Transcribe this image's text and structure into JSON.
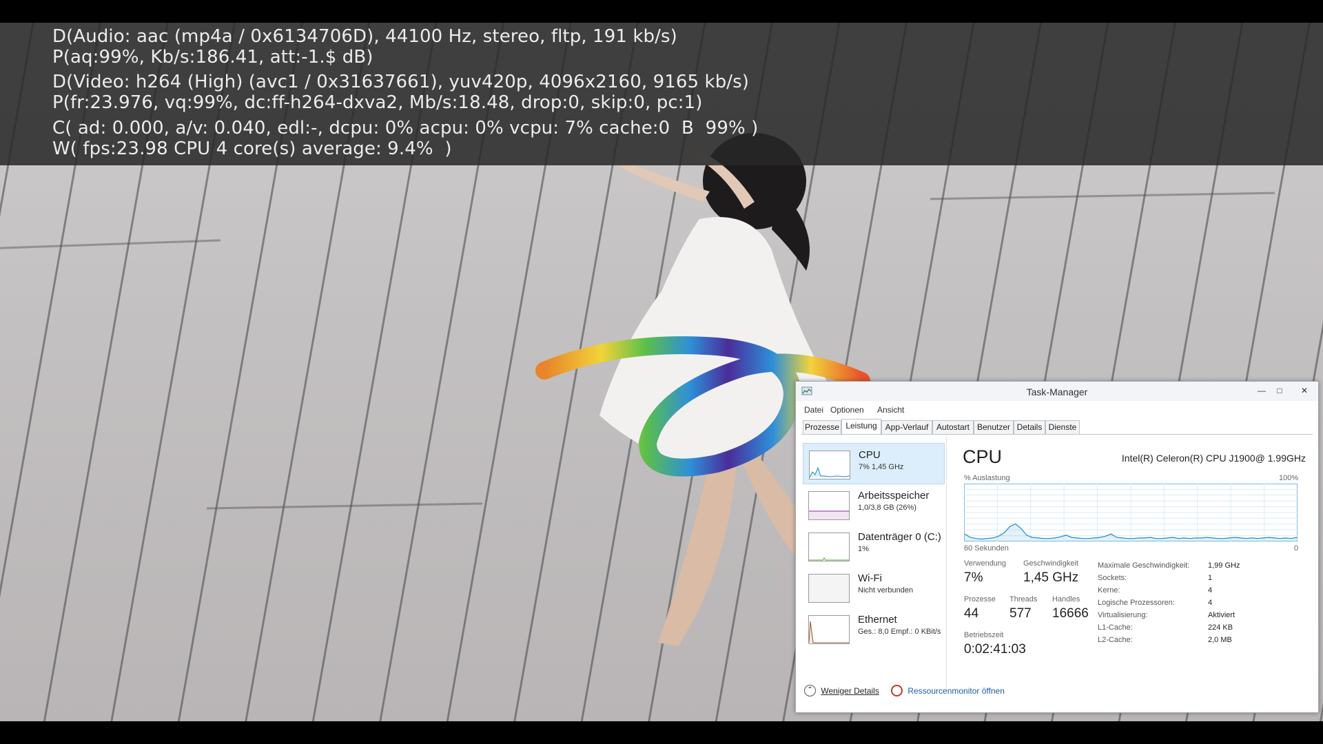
{
  "osd": {
    "line1": "D(Audio: aac (mp4a / 0x6134706D), 44100 Hz, stereo, fltp, 191 kb/s)",
    "line2": "P(aq:99%, Kb/s:186.41, att:-1.$ dB)",
    "line3": "D(Video: h264 (High) (avc1 / 0x31637661), yuv420p, 4096x2160, 9165 kb/s)",
    "line4": "P(fr:23.976, vq:99%, dc:ff-h264-dxva2, Mb/s:18.48, drop:0, skip:0, pc:1)",
    "line5": "C( ad: 0.000, a/v: 0.040, edl:-, dcpu: 0% acpu: 0% vcpu: 7% cache:0  B  99% )",
    "line6": "W( fps:23.98 CPU 4 core(s) average: 9.4%  )"
  },
  "taskmanager": {
    "title": "Task-Manager",
    "app_icon": "task-manager-icon",
    "menu": [
      "Datei",
      "Optionen",
      "Ansicht"
    ],
    "tabs": [
      "Prozesse",
      "Leistung",
      "App-Verlauf",
      "Autostart",
      "Benutzer",
      "Details",
      "Dienste"
    ],
    "active_tab": "Leistung",
    "sidebar": [
      {
        "name": "CPU",
        "sub": "7% 1,45 GHz",
        "color": "#1a8ccf"
      },
      {
        "name": "Arbeitsspeicher",
        "sub": "1,0/3,8 GB (26%)",
        "color": "#8e2aa6"
      },
      {
        "name": "Datenträger 0 (C:)",
        "sub": "1%",
        "color": "#4ea72e"
      },
      {
        "name": "Wi-Fi",
        "sub": "Nicht verbunden",
        "color": "#b0b0b0"
      },
      {
        "name": "Ethernet",
        "sub": "Ges.: 8,0 Empf.: 0 KBit/s",
        "color": "#a0522d"
      }
    ],
    "detail": {
      "title": "CPU",
      "model": "Intel(R) Celeron(R) CPU J1900@ 1.99GHz",
      "graph_label": "% Auslastung",
      "graph_max": "100%",
      "graph_time": "60 Sekunden",
      "graph_min": "0",
      "util_samples": [
        12,
        6,
        4,
        3,
        4,
        5,
        8,
        14,
        25,
        30,
        22,
        10,
        6,
        5,
        4,
        4,
        5,
        7,
        10,
        6,
        5,
        4,
        4,
        5,
        6,
        8,
        12,
        6,
        5,
        4,
        4,
        5,
        5,
        6,
        4,
        4,
        5,
        6,
        4,
        5,
        4,
        5,
        5,
        6,
        5,
        4,
        4,
        5,
        6,
        5,
        4,
        5,
        4,
        5,
        6,
        5,
        4,
        5,
        4,
        6
      ],
      "verwendung_label": "Verwendung",
      "verwendung": "7%",
      "geschwindigkeit_label": "Geschwindigkeit",
      "geschwindigkeit": "1,45 GHz",
      "prozesse_label": "Prozesse",
      "prozesse": "44",
      "threads_label": "Threads",
      "threads": "577",
      "handles_label": "Handles",
      "handles": "16666",
      "betriebszeit_label": "Betriebszeit",
      "betriebszeit": "0:02:41:03",
      "specs": [
        {
          "k": "Maximale Geschwindigkeit:",
          "v": "1,99 GHz"
        },
        {
          "k": "Sockets:",
          "v": "1"
        },
        {
          "k": "Kerne:",
          "v": "4"
        },
        {
          "k": "Logische Prozessoren:",
          "v": "4"
        },
        {
          "k": "Virtualisierung:",
          "v": "Aktiviert"
        },
        {
          "k": "L1-Cache:",
          "v": "224 KB"
        },
        {
          "k": "L2-Cache:",
          "v": "2,0 MB"
        }
      ]
    },
    "fewer_details": "Weniger Details",
    "resource_monitor": "Ressourcenmonitor öffnen",
    "accent": "#1a8ccf"
  }
}
